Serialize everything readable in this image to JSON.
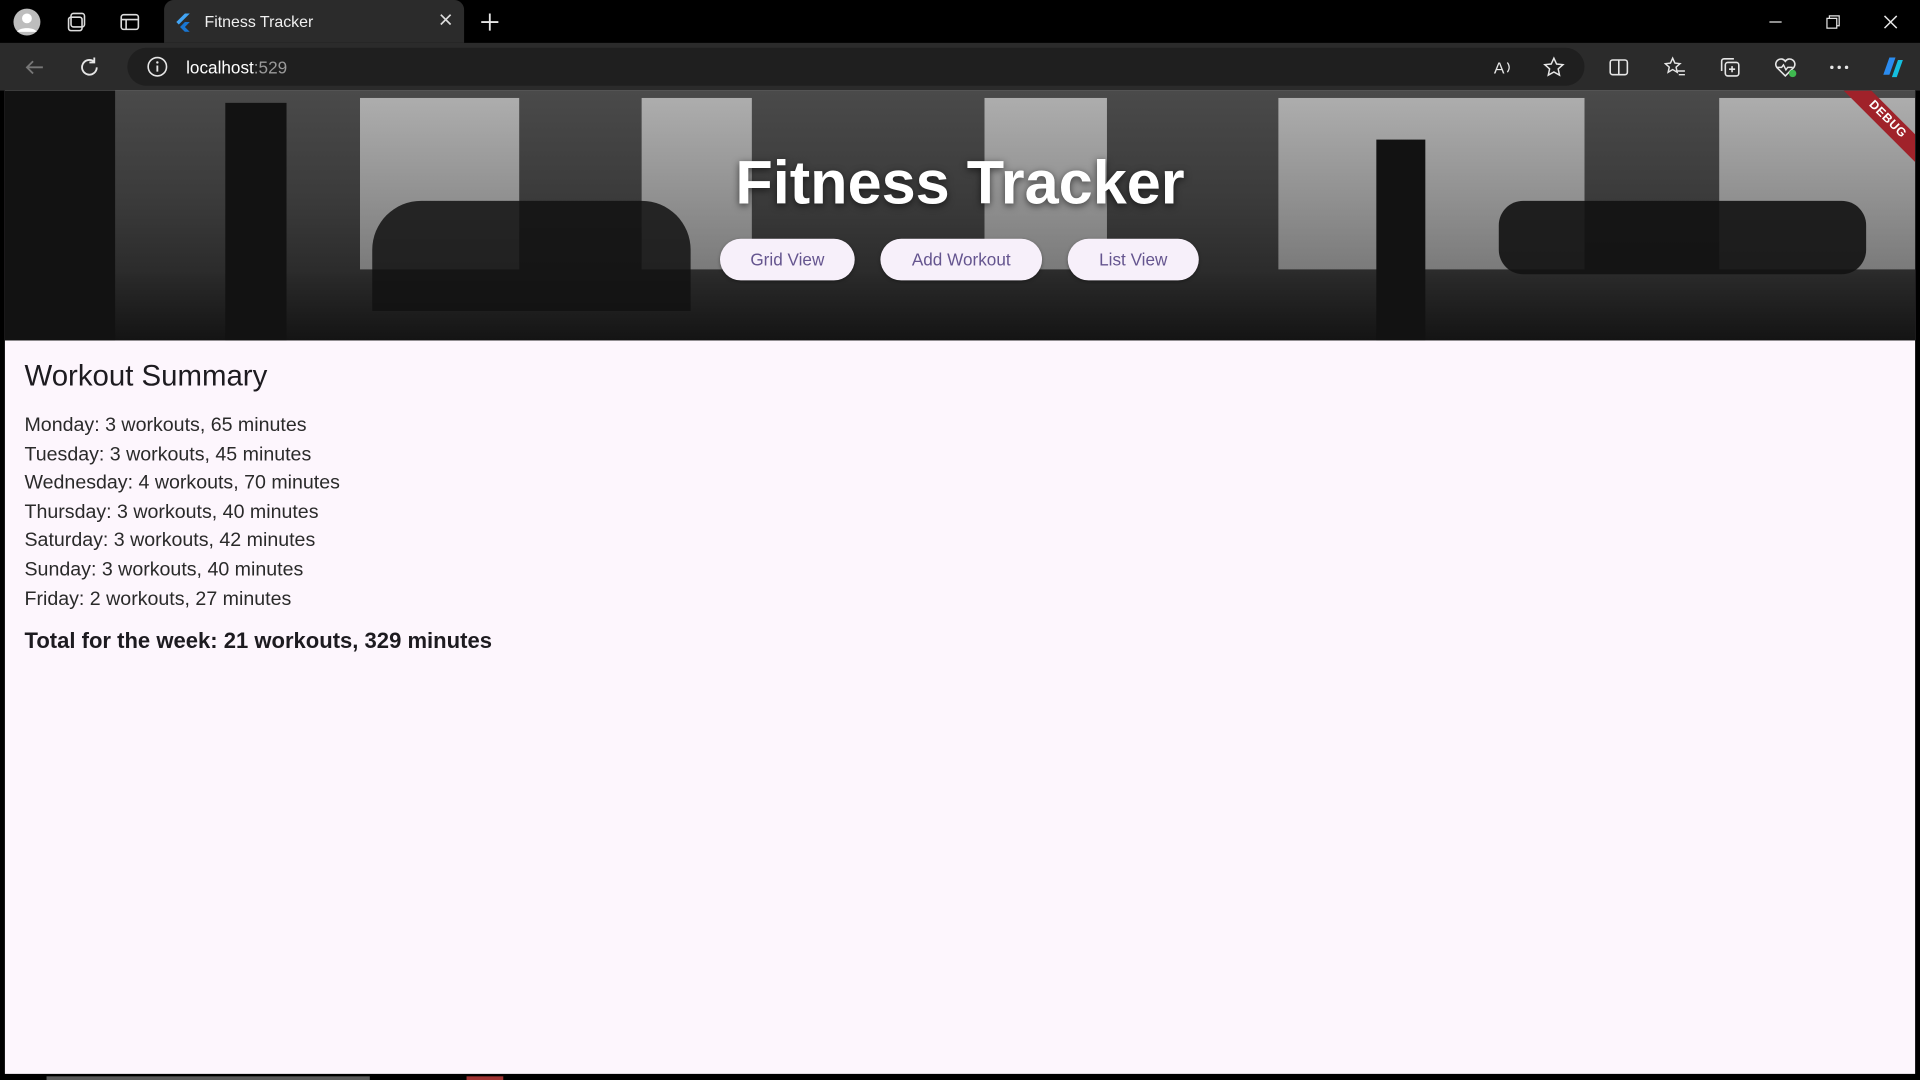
{
  "browser": {
    "tab_title": "Fitness Tracker",
    "url_host": "localhost",
    "url_port": ":529",
    "toolbar_icons": [
      "read-aloud-icon",
      "favorite-star-icon",
      "split-screen-icon",
      "favorites-icon",
      "collections-icon",
      "browser-essentials-icon",
      "more-icon",
      "copilot-icon"
    ]
  },
  "hero": {
    "title": "Fitness Tracker",
    "buttons": [
      "Grid View",
      "Add Workout",
      "List View"
    ],
    "debug_label": "DEBUG"
  },
  "summary": {
    "title": "Workout Summary",
    "days": [
      "Monday: 3 workouts, 65 minutes",
      "Tuesday: 3 workouts, 45 minutes",
      "Wednesday: 4 workouts, 70 minutes",
      "Thursday: 3 workouts, 40 minutes",
      "Saturday: 3 workouts, 42 minutes",
      "Sunday: 3 workouts, 40 minutes",
      "Friday: 2 workouts, 27 minutes"
    ],
    "total": "Total for the week: 21 workouts, 329 minutes"
  },
  "colors": {
    "page_bg": "#fdf6fd",
    "button_bg": "#f7f0fa",
    "button_text": "#65558f",
    "debug_banner": "#a0222a"
  }
}
